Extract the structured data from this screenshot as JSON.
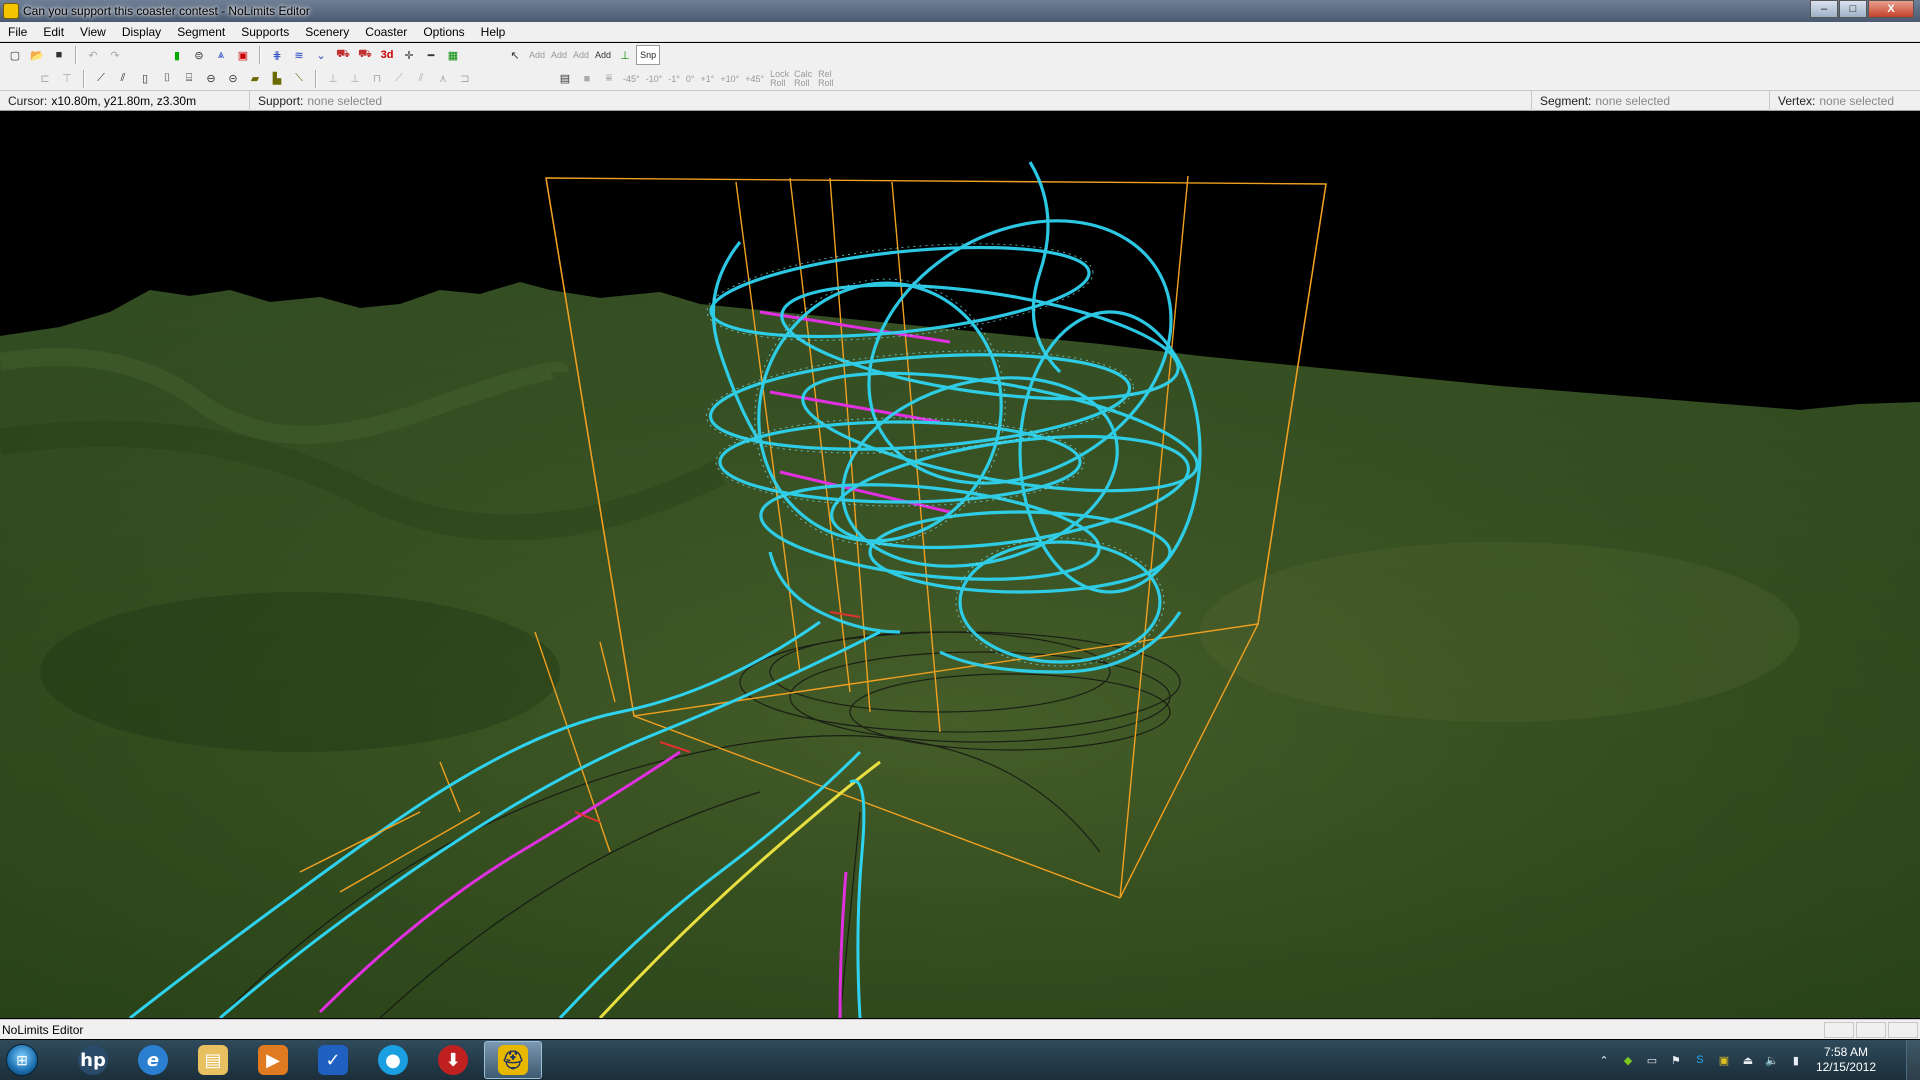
{
  "window": {
    "title": "Can you support this coaster contest - NoLimits Editor",
    "minimize": "–",
    "maximize": "□",
    "close": "X"
  },
  "menu": [
    "File",
    "Edit",
    "View",
    "Display",
    "Segment",
    "Supports",
    "Scenery",
    "Coaster",
    "Options",
    "Help"
  ],
  "toolbar": {
    "three_d_label": "3d",
    "snap_label": "Snp",
    "add_labels": [
      "Add",
      "Add",
      "Add",
      "Add"
    ],
    "angle_labels": [
      "-45°",
      "-10°",
      "-1°",
      "0°",
      "+1°",
      "+10°",
      "+45°"
    ],
    "roll_labels": [
      "Lock Roll",
      "Calc Roll",
      "Rel Roll"
    ]
  },
  "info": {
    "cursor_label": "Cursor:",
    "cursor_value": "x10.80m, y21.80m, z3.30m",
    "support_label": "Support:",
    "support_value": "none selected",
    "segment_label": "Segment:",
    "segment_value": "none selected",
    "vertex_label": "Vertex:",
    "vertex_value": "none selected"
  },
  "status": {
    "text": "NoLimits Editor"
  },
  "taskbar": {
    "apps": [
      "hp-icon",
      "internet-explorer-icon",
      "file-explorer-icon",
      "media-player-icon",
      "check-icon",
      "globe-icon",
      "red-app-icon",
      "nolimits-icon"
    ],
    "time": "7:58 AM",
    "date": "12/15/2012"
  },
  "colors": {
    "track": "#2fd3f0",
    "bounding_box": "#f0a020",
    "chain_lift": "#e030e0",
    "brakes": "#e8e040",
    "sky": "#000000",
    "terrain": "#3b5a24"
  }
}
